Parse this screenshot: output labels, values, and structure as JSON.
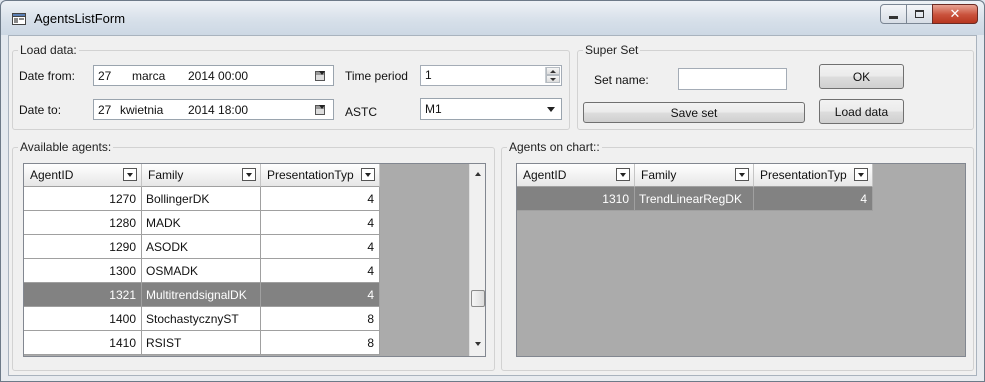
{
  "window": {
    "title": "AgentsListForm"
  },
  "load_data": {
    "group_title": "Load data:",
    "date_from_label": "Date from:",
    "date_from": {
      "day": "27",
      "month": "marca",
      "year_time": "2014 00:00"
    },
    "date_to_label": "Date to:",
    "date_to": {
      "day": "27",
      "month": "kwietnia",
      "year_time": "2014 18:00"
    },
    "time_period_label": "Time period",
    "time_period_value": "1",
    "astc_label": "ASTC",
    "astc_value": "M1"
  },
  "super_set": {
    "group_title": "Super Set",
    "set_name_label": "Set name:",
    "set_name_value": "",
    "save_button": "Save set"
  },
  "buttons": {
    "ok": "OK",
    "load_data": "Load data"
  },
  "available_agents": {
    "group_title": "Available agents:",
    "columns": [
      "AgentID",
      "Family",
      "PresentationTyp"
    ],
    "rows": [
      {
        "id": "1270",
        "family": "BollingerDK",
        "type": "4"
      },
      {
        "id": "1280",
        "family": "MADK",
        "type": "4"
      },
      {
        "id": "1290",
        "family": "ASODK",
        "type": "4"
      },
      {
        "id": "1300",
        "family": "OSMADK",
        "type": "4"
      },
      {
        "id": "1321",
        "family": "MultitrendsignalDK",
        "type": "4"
      },
      {
        "id": "1400",
        "family": "StochastycznyST",
        "type": "8"
      },
      {
        "id": "1410",
        "family": "RSIST",
        "type": "8"
      }
    ],
    "selected_row": 4
  },
  "agents_on_chart": {
    "group_title": "Agents on chart::",
    "columns": [
      "AgentID",
      "Family",
      "PresentationTyp"
    ],
    "rows": [
      {
        "id": "1310",
        "family": "TrendLinearRegDK",
        "type": "4"
      }
    ],
    "selected_row": 0
  }
}
